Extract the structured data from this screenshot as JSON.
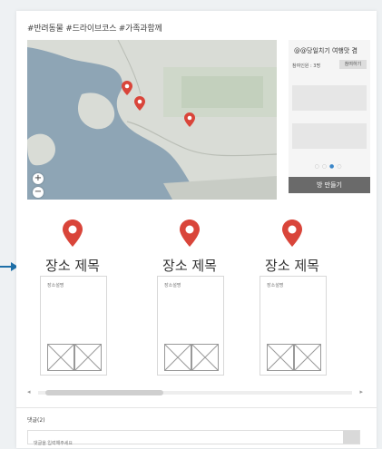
{
  "header": {
    "tags": "#반려동물 #드라이브코스 #가족과함께"
  },
  "map": {
    "zoom_in": "+",
    "zoom_out": "−"
  },
  "trip_card": {
    "title": "@@당일치기 여행맛 겸",
    "people": "참여인원 : 3명",
    "join_label": "참여하기",
    "carousel_dots": [
      "○",
      "○",
      "●",
      "○"
    ],
    "make_room_label": "방 만들기"
  },
  "places": [
    {
      "title": "장소 제목",
      "description": "장소설명"
    },
    {
      "title": "장소 제목",
      "description": "장소설명"
    },
    {
      "title": "장소 제목",
      "description": "장소설명"
    }
  ],
  "scroll": {
    "left_arrow": "◂",
    "right_arrow": "▸"
  },
  "comments": {
    "label": "댓글(2)",
    "placeholder": "댓글을 입력해주세요"
  },
  "colors": {
    "pin": "#d9453a",
    "accent_dot": "#3a86c8",
    "button": "#6a6a6a",
    "pointer_arrow": "#1e6fa8"
  }
}
